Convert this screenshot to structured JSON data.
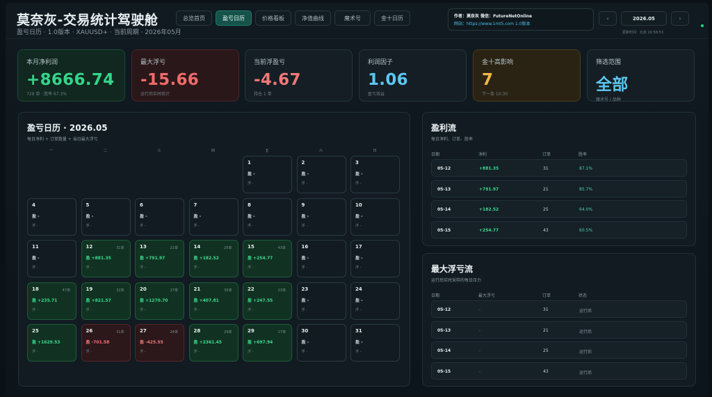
{
  "header": {
    "title": "莫奈灰-交易统计驾驶舱",
    "subtitle": "盈亏日历 · 1.0版本 · XAUUSD+ · 当前周期 · 2026年05月"
  },
  "nav": {
    "tabs": [
      {
        "label": "总览首页",
        "active": false
      },
      {
        "label": "盈亏日历",
        "active": true
      },
      {
        "label": "价格看板",
        "active": false
      },
      {
        "label": "净值曲线",
        "active": false
      },
      {
        "label": "魔术号",
        "active": false
      },
      {
        "label": "金十日历",
        "active": false
      }
    ]
  },
  "author": {
    "line": "作者：莫奈灰  微信：FutureNetOnline",
    "link": "网站：https://www.1mt5.com  1.0版本"
  },
  "month_control": {
    "prev": "‹",
    "month": "2026.05",
    "next": "›",
    "updated": "更新时间：北京 20:58:53"
  },
  "kpis": [
    {
      "label": "本月净利润",
      "value": "+8666.74",
      "note": "729 单 · 胜率 67.3%",
      "style": "green"
    },
    {
      "label": "最大浮亏",
      "value": "-15.66",
      "note": "运行后实时统计",
      "style": "red"
    },
    {
      "label": "当前浮盈亏",
      "value": "-4.67",
      "note": "持仓 1 单",
      "style": "plain-red"
    },
    {
      "label": "利润因子",
      "value": "1.06",
      "note": "盈亏效益",
      "style": "blue"
    },
    {
      "label": "金十高影响",
      "value": "7",
      "note": "下一条 10:30",
      "style": "amber"
    },
    {
      "label": "筛选范围",
      "value": "全部",
      "note": "魔术号 / 品种",
      "style": "cyan"
    }
  ],
  "calendar": {
    "title": "盈亏日历 · 2026.05",
    "subtitle": "每日净利 + 订单数量 + 当日最大浮亏",
    "weekdays": [
      "一",
      "二",
      "三",
      "四",
      "五",
      "六",
      "日"
    ],
    "pnl_prefix": "盈",
    "float_prefix": "浮",
    "days": [
      {
        "day": "1",
        "pnl": "-",
        "orders": "",
        "style": ""
      },
      {
        "day": "2",
        "pnl": "-",
        "orders": "",
        "style": ""
      },
      {
        "day": "3",
        "pnl": "-",
        "orders": "",
        "style": ""
      },
      {
        "day": "4",
        "pnl": "-",
        "orders": "",
        "style": ""
      },
      {
        "day": "5",
        "pnl": "-",
        "orders": "",
        "style": ""
      },
      {
        "day": "6",
        "pnl": "-",
        "orders": "",
        "style": ""
      },
      {
        "day": "7",
        "pnl": "-",
        "orders": "",
        "style": ""
      },
      {
        "day": "8",
        "pnl": "-",
        "orders": "",
        "style": ""
      },
      {
        "day": "9",
        "pnl": "-",
        "orders": "",
        "style": ""
      },
      {
        "day": "10",
        "pnl": "-",
        "orders": "",
        "style": ""
      },
      {
        "day": "11",
        "pnl": "-",
        "orders": "",
        "style": ""
      },
      {
        "day": "12",
        "pnl": "+881.35",
        "orders": "31单",
        "style": "g"
      },
      {
        "day": "13",
        "pnl": "+791.97",
        "orders": "21单",
        "style": "g"
      },
      {
        "day": "14",
        "pnl": "+182.52",
        "orders": "25单",
        "style": "g"
      },
      {
        "day": "15",
        "pnl": "+254.77",
        "orders": "43单",
        "style": "g"
      },
      {
        "day": "16",
        "pnl": "-",
        "orders": "",
        "style": ""
      },
      {
        "day": "17",
        "pnl": "-",
        "orders": "",
        "style": ""
      },
      {
        "day": "18",
        "pnl": "+235.71",
        "orders": "47单",
        "style": "g"
      },
      {
        "day": "19",
        "pnl": "+821.57",
        "orders": "32单",
        "style": "g"
      },
      {
        "day": "20",
        "pnl": "+1270.70",
        "orders": "27单",
        "style": "g"
      },
      {
        "day": "21",
        "pnl": "+407.81",
        "orders": "35单",
        "style": "g"
      },
      {
        "day": "22",
        "pnl": "+247.55",
        "orders": "23单",
        "style": "g"
      },
      {
        "day": "23",
        "pnl": "-",
        "orders": "",
        "style": ""
      },
      {
        "day": "24",
        "pnl": "-",
        "orders": "",
        "style": ""
      },
      {
        "day": "25",
        "pnl": "+1629.53",
        "orders": "",
        "style": "g"
      },
      {
        "day": "26",
        "pnl": "-701.58",
        "orders": "31单",
        "style": "r"
      },
      {
        "day": "27",
        "pnl": "-425.55",
        "orders": "24单",
        "style": "r"
      },
      {
        "day": "28",
        "pnl": "+2361.45",
        "orders": "29单",
        "style": "g"
      },
      {
        "day": "29",
        "pnl": "+697.94",
        "orders": "17单",
        "style": "g"
      },
      {
        "day": "30",
        "pnl": "-",
        "orders": "",
        "style": ""
      },
      {
        "day": "31",
        "pnl": "-",
        "orders": "",
        "style": ""
      }
    ]
  },
  "profit_flow": {
    "title": "盈利流",
    "subtitle": "每日净利、订单、胜率",
    "headers": [
      "日期",
      "净利",
      "订单",
      "胜率"
    ],
    "rows": [
      {
        "date": "05-12",
        "net": "+881.35",
        "orders": "31",
        "winrate": "87.1%"
      },
      {
        "date": "05-13",
        "net": "+791.97",
        "orders": "21",
        "winrate": "85.7%"
      },
      {
        "date": "05-14",
        "net": "+182.52",
        "orders": "25",
        "winrate": "64.0%"
      },
      {
        "date": "05-15",
        "net": "+254.77",
        "orders": "43",
        "winrate": "60.5%"
      }
    ]
  },
  "float_flow": {
    "title": "最大浮亏流",
    "subtitle": "运行后实时采样的每日压力",
    "headers": [
      "日期",
      "最大浮亏",
      "订单",
      "状态"
    ],
    "rows": [
      {
        "date": "05-12",
        "maxfloat": "-",
        "orders": "31",
        "status": "运行后"
      },
      {
        "date": "05-13",
        "maxfloat": "-",
        "orders": "21",
        "status": "运行后"
      },
      {
        "date": "05-14",
        "maxfloat": "-",
        "orders": "25",
        "status": "运行后"
      },
      {
        "date": "05-15",
        "maxfloat": "-",
        "orders": "43",
        "status": "运行后"
      }
    ]
  }
}
